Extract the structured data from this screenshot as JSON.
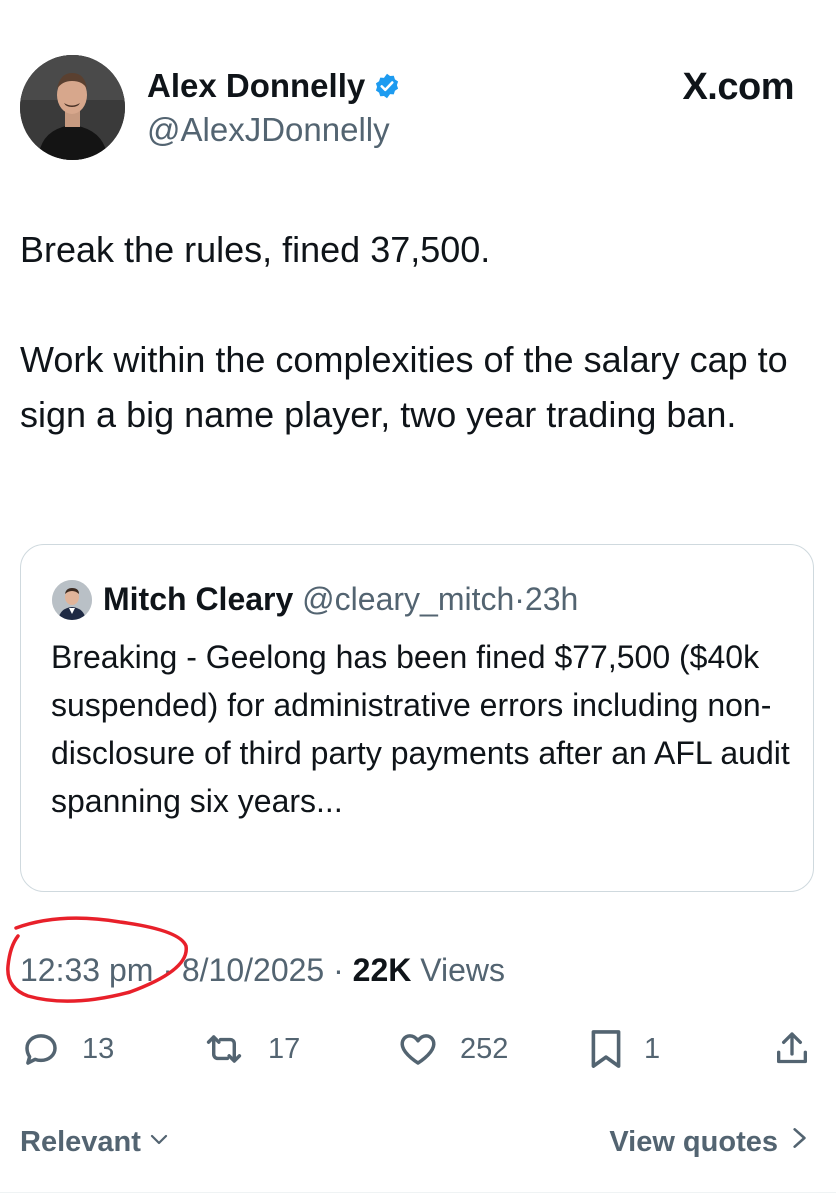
{
  "author": {
    "name": "Alex Donnelly",
    "handle": "@AlexJDonnelly",
    "verified": true
  },
  "brand": "X.com",
  "tweet": {
    "paragraphs": [
      "Break the rules, fined 37,500.",
      "Work within the complexities of the salary cap to sign a big name player, two year trading ban."
    ]
  },
  "quote": {
    "name": "Mitch Cleary",
    "handle": "@cleary_mitch",
    "separator": "·",
    "time": "23h",
    "text": "Breaking - Geelong has been fined $77,500 ($40k suspended) for administrative errors including non-disclosure of third party payments after an AFL audit spanning six years..."
  },
  "meta": {
    "time": "12:33 pm",
    "separator": "·",
    "date": "8/10/2025",
    "views_count": "22K",
    "views_label": "Views"
  },
  "actions": {
    "replies": "13",
    "reposts": "17",
    "likes": "252",
    "bookmarks": "1"
  },
  "footer": {
    "sort_label": "Relevant",
    "view_quotes_label": "View quotes"
  },
  "colors": {
    "verified_badge": "#1d9bf0",
    "secondary_text": "#536471",
    "annotation": "#e8202a"
  },
  "icons": {
    "reply": "reply-icon",
    "repost": "repost-icon",
    "like": "heart-icon",
    "bookmark": "bookmark-icon",
    "share": "share-icon"
  }
}
